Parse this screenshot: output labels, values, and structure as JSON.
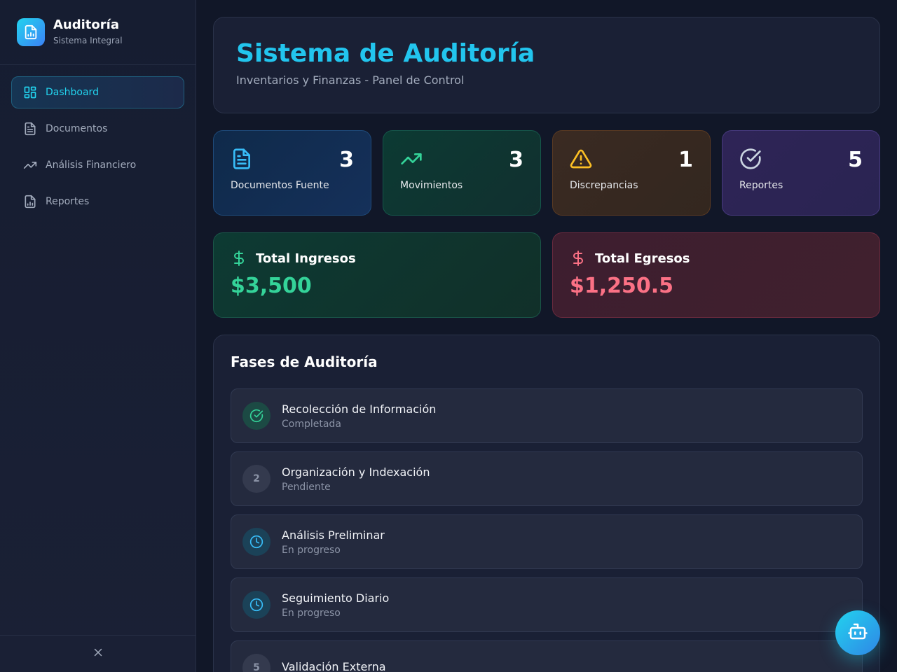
{
  "brand": {
    "title": "Auditoría",
    "subtitle": "Sistema Integral"
  },
  "sidebar": {
    "items": [
      {
        "label": "Dashboard",
        "icon": "dashboard-icon",
        "active": true
      },
      {
        "label": "Documentos",
        "icon": "document-icon"
      },
      {
        "label": "Análisis Financiero",
        "icon": "trending-up-icon"
      },
      {
        "label": "Reportes",
        "icon": "report-icon"
      }
    ]
  },
  "header": {
    "title": "Sistema de Auditoría",
    "subtitle": "Inventarios y Finanzas - Panel de Control"
  },
  "stats": [
    {
      "value": "3",
      "label": "Documentos Fuente",
      "icon": "file-text-icon",
      "color": "#38bdf8"
    },
    {
      "value": "3",
      "label": "Movimientos",
      "icon": "trending-up-icon",
      "color": "#34d399"
    },
    {
      "value": "1",
      "label": "Discrepancias",
      "icon": "warning-icon",
      "color": "#fbbf24"
    },
    {
      "value": "5",
      "label": "Reportes",
      "icon": "check-circle-icon",
      "color": "#cbd5e1"
    }
  ],
  "totals": {
    "income": {
      "label": "Total Ingresos",
      "value": "$3,500",
      "color": "#34d399"
    },
    "expense": {
      "label": "Total Egresos",
      "value": "$1,250.5",
      "color": "#fb7185"
    }
  },
  "phases": {
    "title": "Fases de Auditoría",
    "items": [
      {
        "name": "Recolección de Información",
        "status": "Completada",
        "badge": "",
        "state": "done"
      },
      {
        "name": "Organización y Indexación",
        "status": "Pendiente",
        "badge": "2",
        "state": "pending"
      },
      {
        "name": "Análisis Preliminar",
        "status": "En progreso",
        "badge": "",
        "state": "progress"
      },
      {
        "name": "Seguimiento Diario",
        "status": "En progreso",
        "badge": "",
        "state": "progress"
      },
      {
        "name": "Validación Externa",
        "status": "",
        "badge": "5",
        "state": "pending"
      }
    ]
  },
  "colors": {
    "accent": "#22d3ee",
    "background": "#111728"
  }
}
